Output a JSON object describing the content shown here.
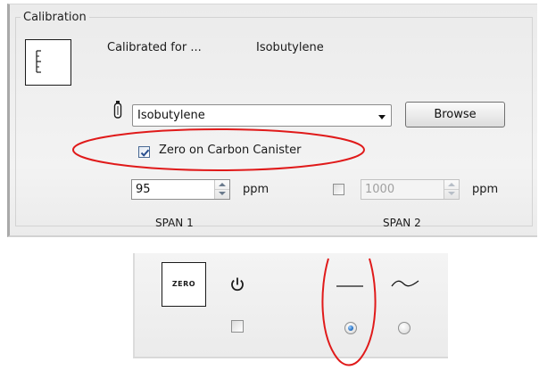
{
  "calibration": {
    "group_title": "Calibration",
    "calibrated_for_label": "Calibrated for ...",
    "calibrated_for_value": "Isobutylene",
    "gas_select": {
      "selected": "Isobutylene"
    },
    "browse_label": "Browse",
    "zero_on_canister": {
      "label": "Zero on Carbon Canister",
      "checked": true
    },
    "span1": {
      "value": "95",
      "unit": "ppm",
      "label": "SPAN 1"
    },
    "span2": {
      "enabled": false,
      "value": "1000",
      "unit": "ppm",
      "label": "SPAN 2"
    }
  },
  "zero_panel": {
    "icon_text": "ZERO",
    "checkbox_checked": false,
    "radio_selected": "steady"
  },
  "icons": {
    "calibration": "calibration-ruler-icon",
    "gas_cylinder": "gas-cylinder-icon",
    "power": "power-icon",
    "steady": "flat-line-icon",
    "wave": "wave-line-icon"
  },
  "colors": {
    "annotation": "#e01a1a",
    "checkbox_tick": "#2a4f8f"
  }
}
